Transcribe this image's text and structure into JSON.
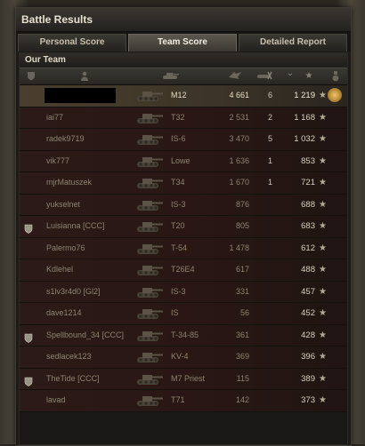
{
  "window": {
    "title": "Battle Results"
  },
  "tabs": [
    {
      "label": "Personal Score",
      "active": false
    },
    {
      "label": "Team Score",
      "active": true
    },
    {
      "label": "Detailed Report",
      "active": false
    }
  ],
  "team": {
    "title": "Our Team"
  },
  "rows": [
    {
      "name": "",
      "vehicle": "M12",
      "damage": "4 661",
      "kills": "6",
      "xp": "1 219",
      "clan": false,
      "me": true,
      "medal": true
    },
    {
      "name": "iai77",
      "vehicle": "T32",
      "damage": "2 531",
      "kills": "2",
      "xp": "1 168",
      "clan": false
    },
    {
      "name": "radek9719",
      "vehicle": "IS-6",
      "damage": "3 470",
      "kills": "5",
      "xp": "1 032",
      "clan": false
    },
    {
      "name": "vik777",
      "vehicle": "Lowe",
      "damage": "1 636",
      "kills": "1",
      "xp": "853",
      "clan": false
    },
    {
      "name": "mjrMatuszek",
      "vehicle": "T34",
      "damage": "1 670",
      "kills": "1",
      "xp": "721",
      "clan": false
    },
    {
      "name": "yukselnet",
      "vehicle": "IS-3",
      "damage": "876",
      "kills": "",
      "xp": "688",
      "clan": false
    },
    {
      "name": "Luisianna [CCC]",
      "vehicle": "T20",
      "damage": "805",
      "kills": "",
      "xp": "683",
      "clan": true
    },
    {
      "name": "Palermo76",
      "vehicle": "T-54",
      "damage": "1 478",
      "kills": "",
      "xp": "612",
      "clan": false
    },
    {
      "name": "Kdlehel",
      "vehicle": "T26E4",
      "damage": "617",
      "kills": "",
      "xp": "488",
      "clan": false
    },
    {
      "name": "s1lv3r4d0 [Gl2]",
      "vehicle": "IS-3",
      "damage": "331",
      "kills": "",
      "xp": "457",
      "clan": false
    },
    {
      "name": "dave1214",
      "vehicle": "IS",
      "damage": "56",
      "kills": "",
      "xp": "452",
      "clan": false
    },
    {
      "name": "Spellbound_34 [CCC]",
      "vehicle": "T-34-85",
      "damage": "361",
      "kills": "",
      "xp": "428",
      "clan": true
    },
    {
      "name": "sedlacek123",
      "vehicle": "KV-4",
      "damage": "369",
      "kills": "",
      "xp": "396",
      "clan": false
    },
    {
      "name": "TheTide [CCC]",
      "vehicle": "M7 Priest",
      "damage": "115",
      "kills": "",
      "xp": "389",
      "clan": true
    },
    {
      "name": "lavad",
      "vehicle": "T71",
      "damage": "142",
      "kills": "",
      "xp": "373",
      "clan": false
    }
  ]
}
